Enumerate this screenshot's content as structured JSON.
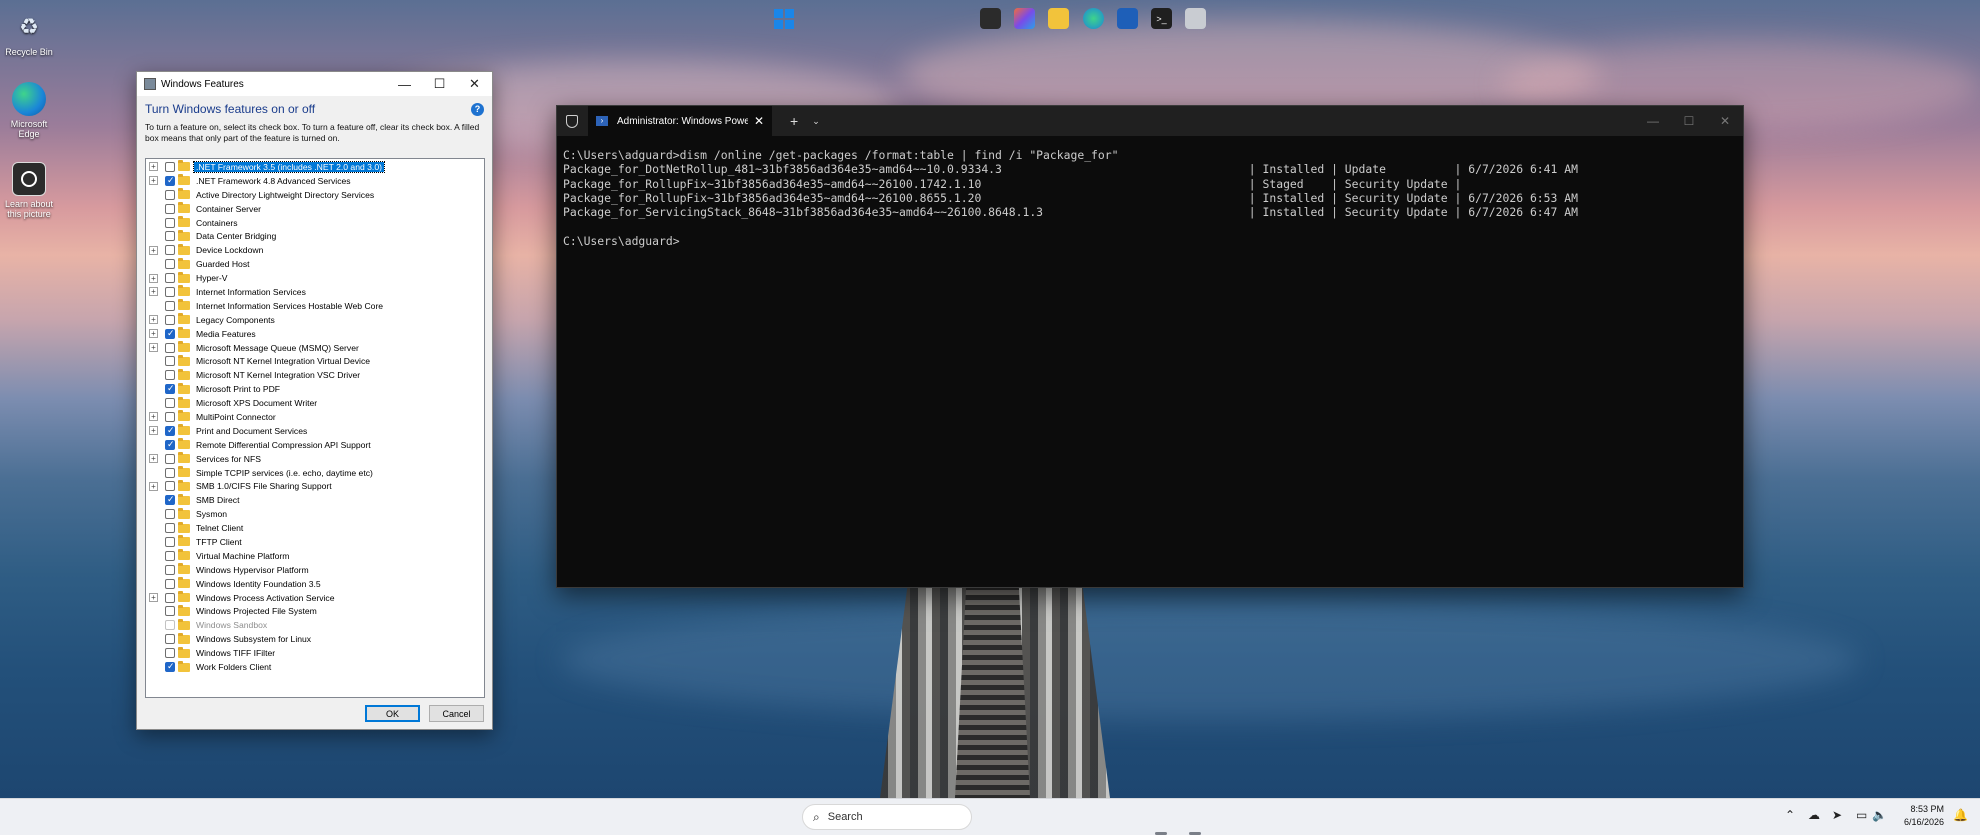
{
  "desktop": {
    "icons": [
      {
        "label": "Recycle Bin"
      },
      {
        "label": "Microsoft Edge"
      },
      {
        "label": "Learn about this picture"
      }
    ]
  },
  "features_dialog": {
    "title": "Windows Features",
    "heading": "Turn Windows features on or off",
    "help_label": "?",
    "description": "To turn a feature on, select its check box. To turn a feature off, clear its check box. A filled box means that only part of the feature is turned on.",
    "items": [
      {
        "label": ".NET Framework 3.5 (includes .NET 2.0 and 3.0)",
        "expandable": true,
        "state": "off",
        "selected": true
      },
      {
        "label": ".NET Framework 4.8 Advanced Services",
        "expandable": true,
        "state": "on"
      },
      {
        "label": "Active Directory Lightweight Directory Services",
        "expandable": false,
        "state": "off"
      },
      {
        "label": "Container Server",
        "expandable": false,
        "state": "off"
      },
      {
        "label": "Containers",
        "expandable": false,
        "state": "off"
      },
      {
        "label": "Data Center Bridging",
        "expandable": false,
        "state": "off"
      },
      {
        "label": "Device Lockdown",
        "expandable": true,
        "state": "off"
      },
      {
        "label": "Guarded Host",
        "expandable": false,
        "state": "off"
      },
      {
        "label": "Hyper-V",
        "expandable": true,
        "state": "off"
      },
      {
        "label": "Internet Information Services",
        "expandable": true,
        "state": "off"
      },
      {
        "label": "Internet Information Services Hostable Web Core",
        "expandable": false,
        "state": "off"
      },
      {
        "label": "Legacy Components",
        "expandable": true,
        "state": "off"
      },
      {
        "label": "Media Features",
        "expandable": true,
        "state": "on"
      },
      {
        "label": "Microsoft Message Queue (MSMQ) Server",
        "expandable": true,
        "state": "off"
      },
      {
        "label": "Microsoft NT Kernel Integration Virtual Device",
        "expandable": false,
        "state": "off"
      },
      {
        "label": "Microsoft NT Kernel Integration VSC Driver",
        "expandable": false,
        "state": "off"
      },
      {
        "label": "Microsoft Print to PDF",
        "expandable": false,
        "state": "on"
      },
      {
        "label": "Microsoft XPS Document Writer",
        "expandable": false,
        "state": "off"
      },
      {
        "label": "MultiPoint Connector",
        "expandable": true,
        "state": "off"
      },
      {
        "label": "Print and Document Services",
        "expandable": true,
        "state": "on"
      },
      {
        "label": "Remote Differential Compression API Support",
        "expandable": false,
        "state": "on"
      },
      {
        "label": "Services for NFS",
        "expandable": true,
        "state": "off"
      },
      {
        "label": "Simple TCPIP services (i.e. echo, daytime etc)",
        "expandable": false,
        "state": "off"
      },
      {
        "label": "SMB 1.0/CIFS File Sharing Support",
        "expandable": true,
        "state": "off"
      },
      {
        "label": "SMB Direct",
        "expandable": false,
        "state": "on"
      },
      {
        "label": "Sysmon",
        "expandable": false,
        "state": "off"
      },
      {
        "label": "Telnet Client",
        "expandable": false,
        "state": "off"
      },
      {
        "label": "TFTP Client",
        "expandable": false,
        "state": "off"
      },
      {
        "label": "Virtual Machine Platform",
        "expandable": false,
        "state": "off"
      },
      {
        "label": "Windows Hypervisor Platform",
        "expandable": false,
        "state": "off"
      },
      {
        "label": "Windows Identity Foundation 3.5",
        "expandable": false,
        "state": "off"
      },
      {
        "label": "Windows Process Activation Service",
        "expandable": true,
        "state": "off"
      },
      {
        "label": "Windows Projected File System",
        "expandable": false,
        "state": "off"
      },
      {
        "label": "Windows Sandbox",
        "expandable": false,
        "state": "off",
        "disabled": true
      },
      {
        "label": "Windows Subsystem for Linux",
        "expandable": false,
        "state": "off"
      },
      {
        "label": "Windows TIFF IFilter",
        "expandable": false,
        "state": "off"
      },
      {
        "label": "Work Folders Client",
        "expandable": false,
        "state": "on"
      }
    ],
    "ok_label": "OK",
    "cancel_label": "Cancel"
  },
  "terminal": {
    "tab_title": "Administrator: Windows Powe",
    "lines": [
      "C:\\Users\\adguard>dism /online /get-packages /format:table | find /i \"Package_for\"",
      "Package_for_DotNetRollup_481~31bf3856ad364e35~amd64~~10.0.9334.3                                    | Installed | Update          | 6/7/2026 6:41 AM",
      "Package_for_RollupFix~31bf3856ad364e35~amd64~~26100.1742.1.10                                       | Staged    | Security Update |",
      "Package_for_RollupFix~31bf3856ad364e35~amd64~~26100.8655.1.20                                       | Installed | Security Update | 6/7/2026 6:53 AM",
      "Package_for_ServicingStack_8648~31bf3856ad364e35~amd64~~26100.8648.1.3                              | Installed | Security Update | 6/7/2026 6:47 AM",
      "",
      "C:\\Users\\adguard>"
    ]
  },
  "taskbar": {
    "search_placeholder": "Search",
    "time": "8:53 PM",
    "date": "6/16/2026"
  }
}
